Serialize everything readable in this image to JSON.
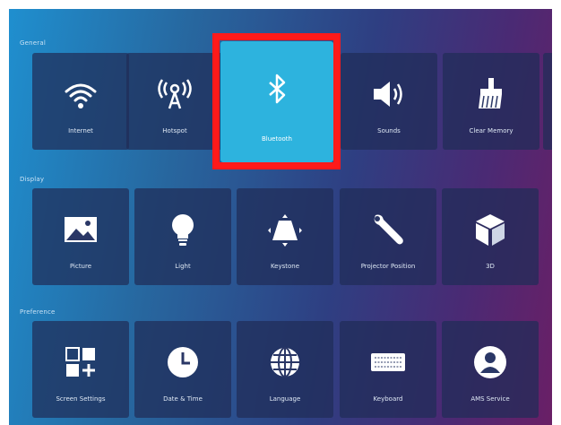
{
  "sections": [
    {
      "label": "General",
      "tiles": [
        {
          "label": "Internet",
          "icon": "wifi-icon"
        },
        {
          "label": "Hotspot",
          "icon": "hotspot-icon"
        },
        {
          "label": "Bluetooth",
          "icon": "bluetooth-icon",
          "selected": true
        },
        {
          "label": "Sounds",
          "icon": "speaker-icon"
        },
        {
          "label": "Clear Memory",
          "icon": "broom-icon"
        }
      ]
    },
    {
      "label": "Display",
      "tiles": [
        {
          "label": "Picture",
          "icon": "picture-icon"
        },
        {
          "label": "Light",
          "icon": "lightbulb-icon"
        },
        {
          "label": "Keystone",
          "icon": "keystone-icon"
        },
        {
          "label": "Projector Position",
          "icon": "wrench-icon"
        },
        {
          "label": "3D",
          "icon": "cube-icon"
        }
      ]
    },
    {
      "label": "Preference",
      "tiles": [
        {
          "label": "Screen Settings",
          "icon": "screen-settings-icon"
        },
        {
          "label": "Date & Time",
          "icon": "clock-icon"
        },
        {
          "label": "Language",
          "icon": "globe-icon"
        },
        {
          "label": "Keyboard",
          "icon": "keyboard-icon"
        },
        {
          "label": "AMS Service",
          "icon": "user-icon"
        }
      ]
    }
  ],
  "colors": {
    "selected_tile": "#2db3de",
    "highlight_border": "#ff1a1a"
  }
}
